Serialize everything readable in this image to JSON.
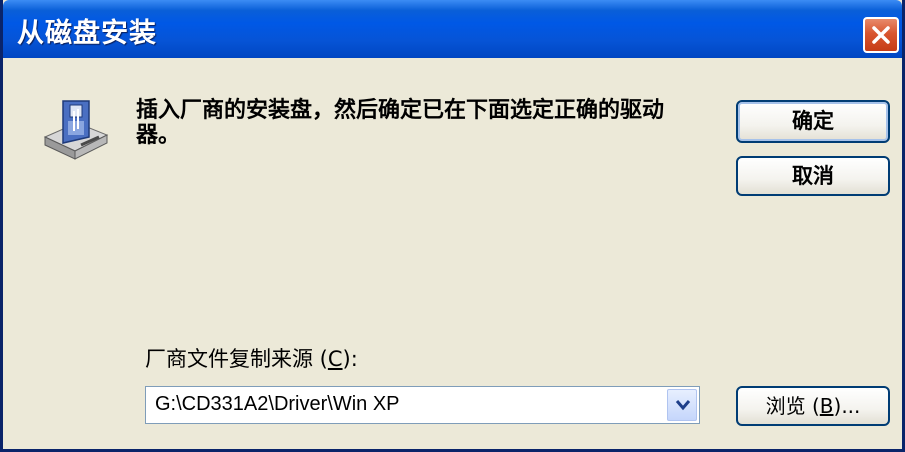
{
  "window": {
    "title": "从磁盘安装"
  },
  "message": "插入厂商的安装盘，然后确定已在下面选定正确的驱动器。",
  "buttons": {
    "ok": "确定",
    "cancel": "取消",
    "browse_prefix": "浏览 (",
    "browse_hotkey": "B",
    "browse_suffix": ")..."
  },
  "source": {
    "label_prefix": "厂商文件复制来源 (",
    "label_hotkey": "C",
    "label_suffix": "):",
    "value": "G:\\CD331A2\\Driver\\Win XP"
  },
  "icons": {
    "dialog_icon": "floppy-drive-icon",
    "close": "close-icon",
    "dropdown": "chevron-down-icon"
  },
  "colors": {
    "titlebar": "#0058e6",
    "close_button": "#d8552f",
    "dialog_bg": "#ece9d8"
  }
}
